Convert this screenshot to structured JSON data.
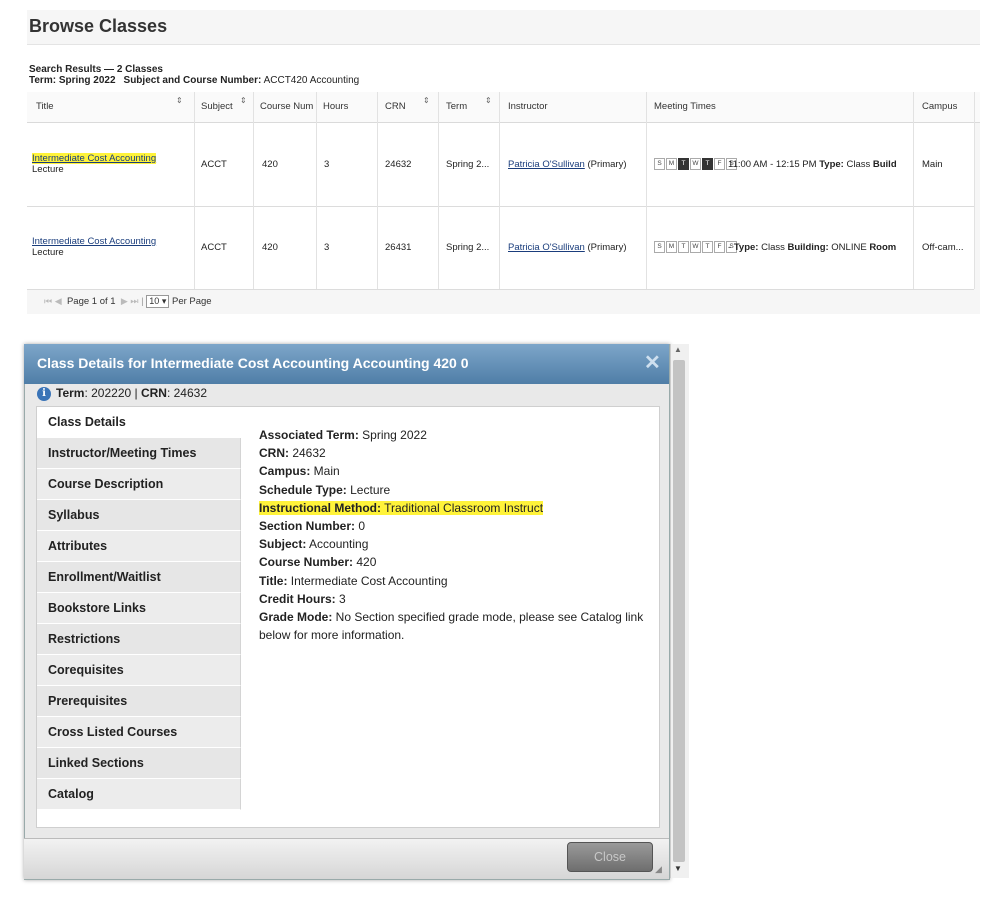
{
  "page": {
    "title": "Browse Classes"
  },
  "results": {
    "heading": "Search Results",
    "count": "— 2 Classes",
    "term_label": "Term:",
    "term_value": "Spring 2022",
    "subject_label": "Subject and Course Number:",
    "subject_value": "ACCT420 Accounting"
  },
  "table": {
    "columns": [
      "Title",
      "Subject",
      "Course Num",
      "Hours",
      "CRN",
      "Term",
      "Instructor",
      "Meeting Times",
      "Campus"
    ],
    "rows": [
      {
        "title": "Intermediate Cost Accounting",
        "schedule": "Lecture",
        "subject": "ACCT",
        "course_num": "420",
        "hours": "3",
        "crn": "24632",
        "term": "Spring 2...",
        "instructor": "Patricia O'Sullivan",
        "instructor_role": "(Primary)",
        "days": [
          "S",
          "M",
          "T",
          "W",
          "T",
          "F",
          "S"
        ],
        "days_on": [
          false,
          false,
          true,
          false,
          true,
          false,
          false
        ],
        "time": "11:00 AM - 12:15 PM",
        "type_label": "Type:",
        "type_value": "Class",
        "building_label": "Build",
        "building_value": "",
        "room_label": "",
        "campus": "Main"
      },
      {
        "title": "Intermediate Cost Accounting",
        "schedule": "Lecture",
        "subject": "ACCT",
        "course_num": "420",
        "hours": "3",
        "crn": "26431",
        "term": "Spring 2...",
        "instructor": "Patricia O'Sullivan",
        "instructor_role": "(Primary)",
        "days": [
          "S",
          "M",
          "T",
          "W",
          "T",
          "F",
          "S"
        ],
        "days_on": [
          false,
          false,
          false,
          false,
          false,
          false,
          false
        ],
        "time": "-",
        "type_label": "Type:",
        "type_value": "Class",
        "building_label": "Building:",
        "building_value": "ONLINE",
        "room_label": "Room",
        "campus": "Off-cam..."
      }
    ]
  },
  "pager": {
    "page_label": "Page",
    "page_num": "1",
    "of_label": "of 1",
    "per_page_value": "10",
    "per_page_label": "Per Page"
  },
  "modal": {
    "title": "Class Details for Intermediate Cost Accounting Accounting 420 0",
    "term_label": "Term",
    "term_value": ": 202220 |",
    "crn_label": "CRN",
    "crn_value": ": 24632",
    "tabs": [
      "Class Details",
      "Instructor/Meeting Times",
      "Course Description",
      "Syllabus",
      "Attributes",
      "Enrollment/Waitlist",
      "Bookstore Links",
      "Restrictions",
      "Corequisites",
      "Prerequisites",
      "Cross Listed Courses",
      "Linked Sections",
      "Catalog"
    ],
    "details": [
      {
        "k": "Associated Term:",
        "v": " Spring 2022"
      },
      {
        "k": "CRN:",
        "v": " 24632"
      },
      {
        "k": "Campus:",
        "v": " Main"
      },
      {
        "k": "Schedule Type:",
        "v": " Lecture"
      },
      {
        "k": "Instructional Method:",
        "v": " Traditional Classroom Instruct"
      },
      {
        "k": "Section Number:",
        "v": " 0"
      },
      {
        "k": "Subject:",
        "v": " Accounting"
      },
      {
        "k": "Course Number:",
        "v": " 420"
      },
      {
        "k": "Title:",
        "v": " Intermediate Cost Accounting"
      },
      {
        "k": "Credit Hours:",
        "v": " 3"
      },
      {
        "k": "Grade Mode:",
        "v": " No Section specified grade mode, please see Catalog link below for more information."
      }
    ],
    "close_label": "Close"
  },
  "colors": {
    "highlight": "#fff33a",
    "titlebar": "#5b88b0",
    "link": "#1a3d7c"
  }
}
